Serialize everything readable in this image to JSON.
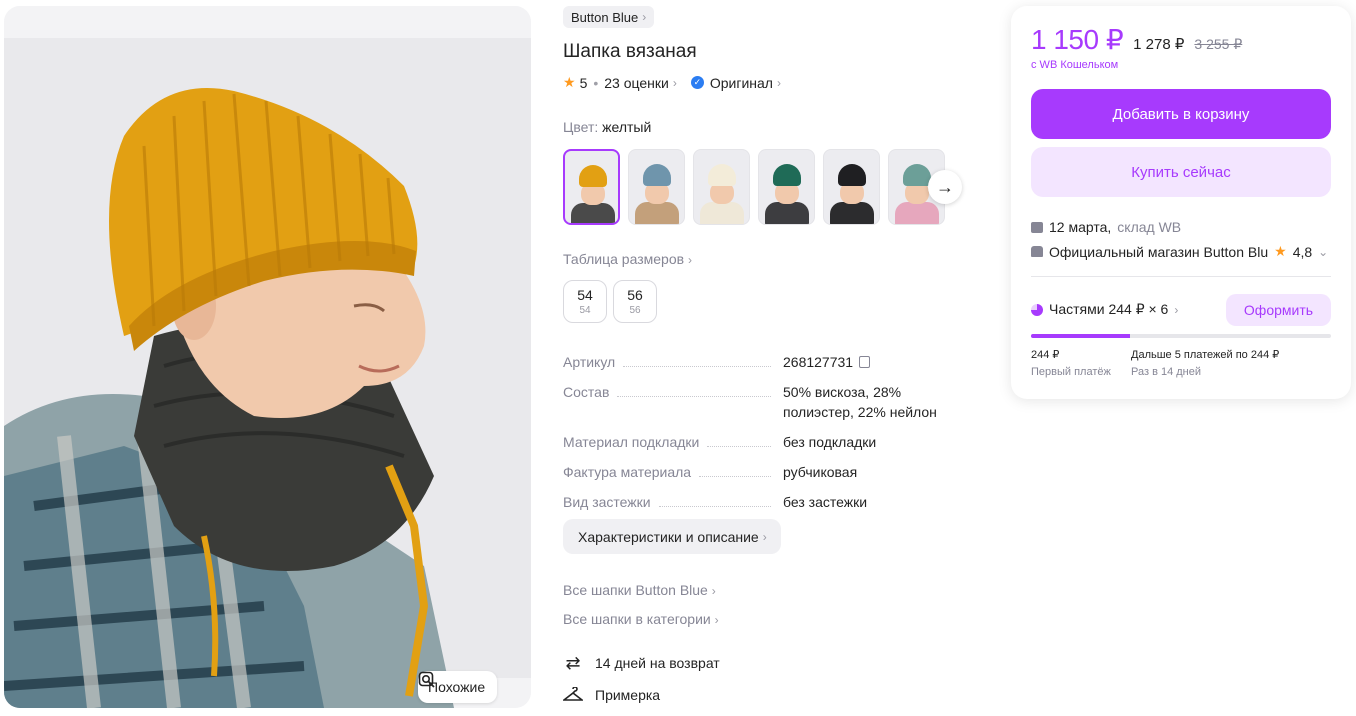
{
  "gallery": {
    "similar_label": "Похожие"
  },
  "product": {
    "brand": "Button Blue",
    "title": "Шапка вязаная",
    "rating": "5",
    "reviews": "23 оценки",
    "original_label": "Оригинал",
    "color_label": "Цвет:",
    "color_value": "желтый",
    "swatches": [
      {
        "hat": "#e2a013",
        "body": "#4a4a4a",
        "active": true
      },
      {
        "hat": "#6f95ac",
        "body": "#c3a07b",
        "active": false
      },
      {
        "hat": "#f3ecd9",
        "body": "#efe8d8",
        "active": false
      },
      {
        "hat": "#1f6b57",
        "body": "#3d3d40",
        "active": false
      },
      {
        "hat": "#1f1f22",
        "body": "#2c2c2e",
        "active": false
      },
      {
        "hat": "#6c9f98",
        "body": "#e6a7bd",
        "active": false
      }
    ],
    "size_table_label": "Таблица размеров",
    "sizes": [
      {
        "main": "54",
        "sub": "54"
      },
      {
        "main": "56",
        "sub": "56"
      }
    ],
    "specs": [
      {
        "key": "Артикул",
        "value": "268127731"
      },
      {
        "key": "Состав",
        "value": "50% вискоза, 28% полиэстер, 22% нейлон"
      },
      {
        "key": "Материал подкладки",
        "value": "без подкладки"
      },
      {
        "key": "Фактура материала",
        "value": "рубчиковая"
      },
      {
        "key": "Вид застежки",
        "value": "без застежки"
      }
    ],
    "characteristics_label": "Характеристики и описание",
    "all_brand_link": "Все шапки Button Blue",
    "all_category_link": "Все шапки в категории",
    "return_label": "14 дней на возврат",
    "fitting_label": "Примерка"
  },
  "buy_card": {
    "price_wallet": "1 150 ₽",
    "price": "1 278 ₽",
    "price_old": "3 255 ₽",
    "wallet_note": "с WB Кошельком",
    "add_to_cart": "Добавить в корзину",
    "buy_now": "Купить сейчас",
    "delivery_date": "12 марта,",
    "delivery_warehouse": "склад WB",
    "shop_name": "Официальный магазин Button Blu",
    "shop_rating": "4,8",
    "installment_label": "Частями 244 ₽ × 6",
    "order_button": "Оформить",
    "installment_progress": 0.33,
    "first_payment_amount": "244 ₽",
    "first_payment_label": "Первый платёж",
    "next_payments_amount": "Дальше 5 платежей по 244 ₽",
    "next_payments_label": "Раз в 14 дней"
  },
  "colors": {
    "accent": "#a73afd",
    "accent_light": "#f3e5ff",
    "star": "#ff9a1f",
    "muted_text": "#868695"
  }
}
